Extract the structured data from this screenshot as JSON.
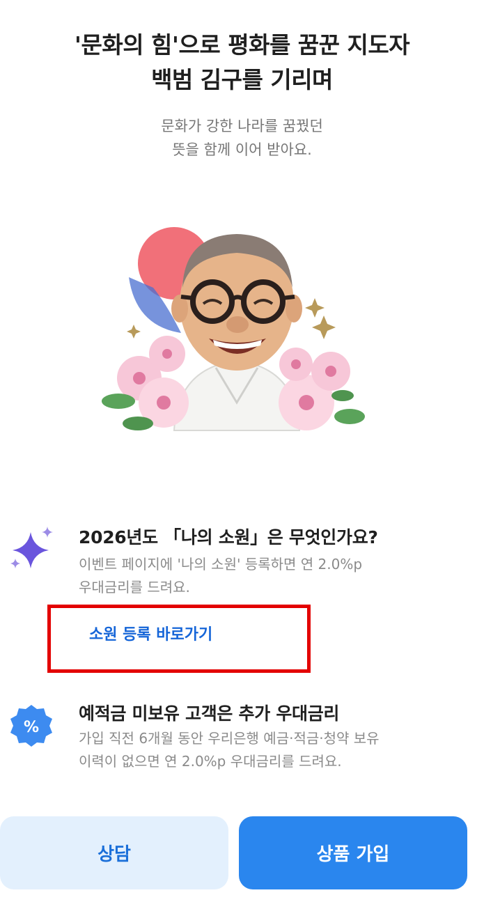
{
  "header": {
    "title_line1": "'문화의 힘'으로 평화를 꿈꾼 지도자",
    "title_line2": "백범 김구를 기리며",
    "subtitle_line1": "문화가 강한 나라를 꿈꿨던",
    "subtitle_line2": "뜻을 함께 이어 받아요."
  },
  "benefits": [
    {
      "icon": "sparkle-icon",
      "title": "2026년도 「나의 소원」은 무엇인가요?",
      "desc_line1": "이벤트 페이지에 '나의 소원' 등록하면 연 2.0%p",
      "desc_line2": "우대금리를 드려요.",
      "link_label": "소원 등록 바로가기"
    },
    {
      "icon": "percent-badge-icon",
      "title": "예적금 미보유 고객은 추가 우대금리",
      "desc_line1": "가입 직전 6개월 동안 우리은행 예금·적금·청약 보유",
      "desc_line2": "이력이 없으면 연 2.0%p 우대금리를 드려요."
    }
  ],
  "actions": {
    "consult_label": "상담",
    "join_label": "상품 가입"
  },
  "colors": {
    "accent": "#2a86ee",
    "accent_light": "#e3f0fd",
    "highlight_border": "#e30000",
    "link": "#1565d8"
  }
}
